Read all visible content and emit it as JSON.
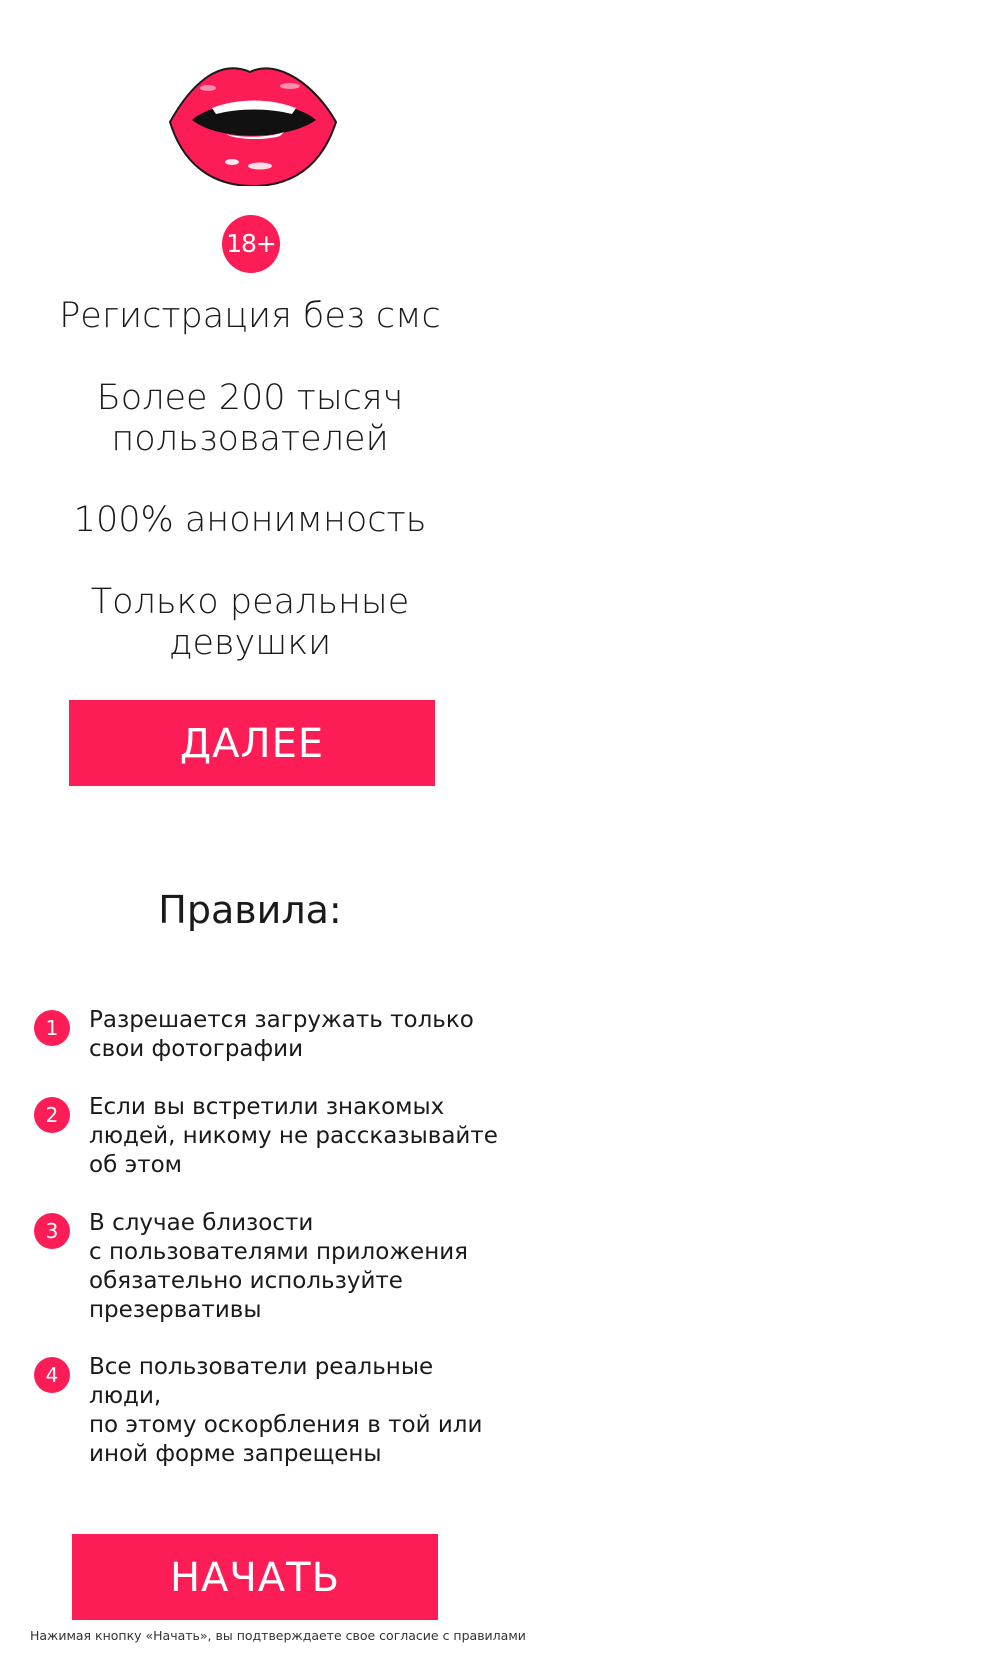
{
  "age_badge": "18+",
  "features": [
    "Регистрация без смс",
    "Более 200 тысяч\nпользователей",
    "100% анонимность",
    "Только реальные\nдевушки"
  ],
  "next_button": "ДАЛЕЕ",
  "rules": {
    "title": "Правила:",
    "items": [
      {
        "number": "1",
        "text": "Разрешается загружать только\nсвои фотографии"
      },
      {
        "number": "2",
        "text": "Если вы встретили знакомых\nлюдей, никому не рассказывайте\nоб этом"
      },
      {
        "number": "3",
        "text": "В случае близости\nс пользователями приложения\nобязательно используйте\nпрезервативы"
      },
      {
        "number": "4",
        "text": "Все пользователи реальные люди,\nпо этому оскорбления в той или\nиной форме запрещены"
      }
    ]
  },
  "start_button": "НАЧАТЬ",
  "consent_text": "Нажимая кнопку «Начать», вы подтверждаете свое согласие с правилами",
  "colors": {
    "accent": "#fd1d56",
    "text": "#1a1a1a",
    "background": "#ffffff"
  },
  "icons": {
    "logo": "lips-icon"
  }
}
